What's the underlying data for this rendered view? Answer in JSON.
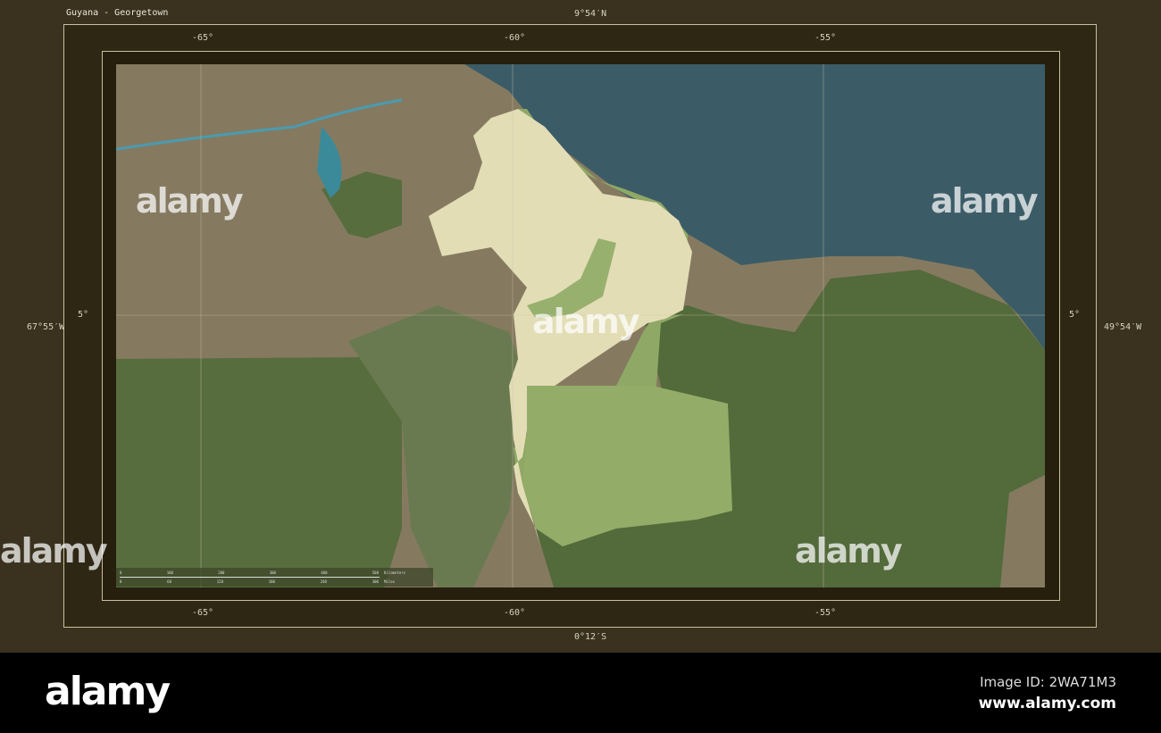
{
  "title": "Guyana - Georgetown",
  "bounds": {
    "north": "9°54′N",
    "south": "0°12′S",
    "west": "67°55′W",
    "east": "49°54′W"
  },
  "longitude_ticks": [
    "-65°",
    "-60°",
    "-55°"
  ],
  "latitude_ticks": [
    "5°"
  ],
  "scale_bar": {
    "km_labels": [
      "0",
      "100",
      "200",
      "300",
      "400",
      "500"
    ],
    "km_unit": "Kilometers",
    "mi_labels": [
      "0",
      "60",
      "120",
      "180",
      "240",
      "300"
    ],
    "mi_unit": "Miles"
  },
  "colors": {
    "highlight": "#e3ddb6",
    "ocean": "#3b5c67",
    "forest": "#586d3e",
    "land": "#857a60"
  },
  "watermark": "alamy",
  "footer": {
    "logo": "alamy",
    "image_id": "Image ID: 2WA71M3",
    "site": "www.alamy.com"
  }
}
